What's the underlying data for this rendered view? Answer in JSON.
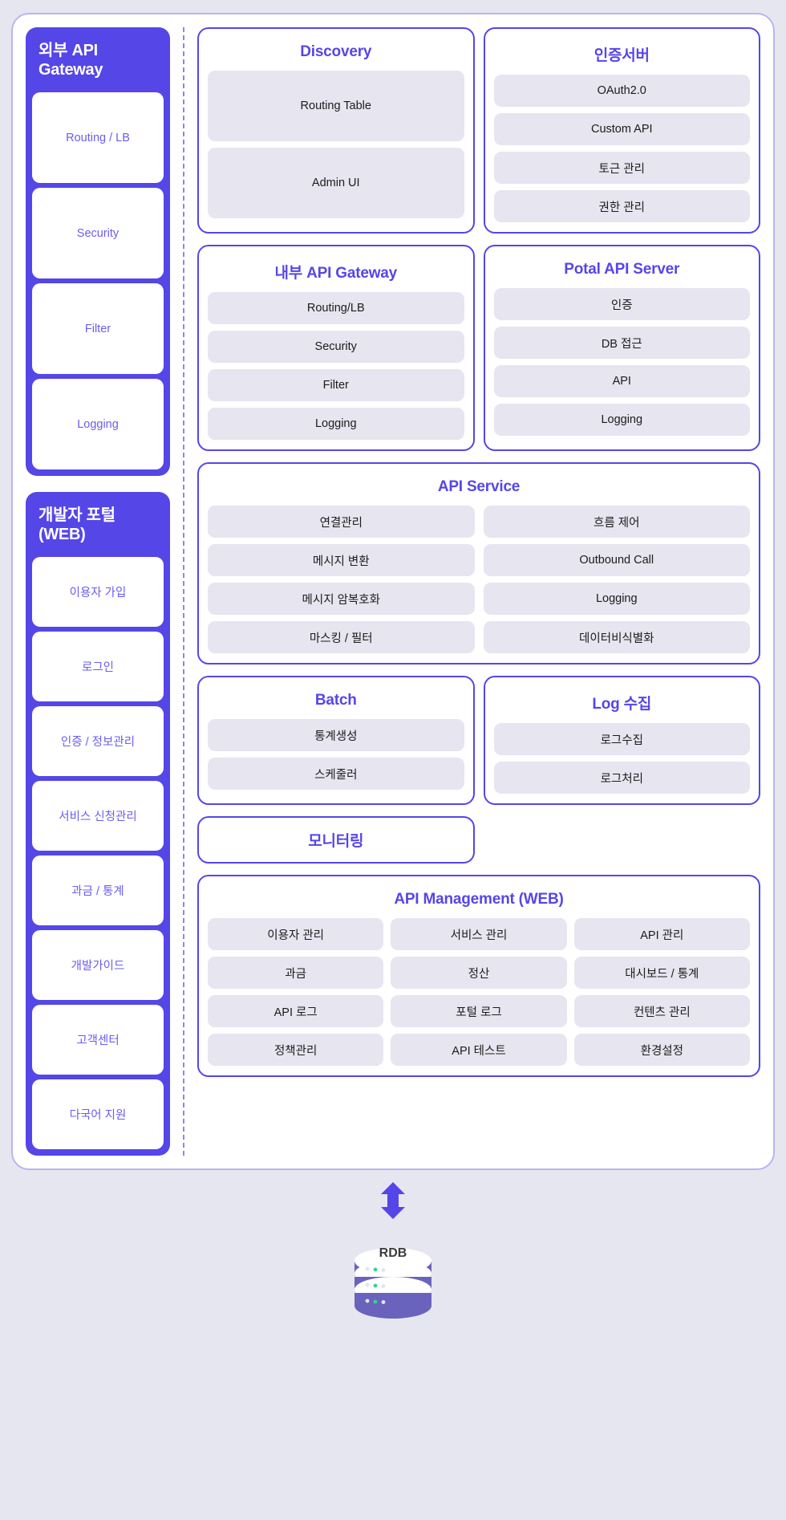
{
  "diagram": {
    "left_rail": [
      {
        "id": "external-api-gateway",
        "title": "외부 API Gateway",
        "items": [
          "Routing / LB",
          "Security",
          "Filter",
          "Logging"
        ]
      },
      {
        "id": "developer-portal",
        "title": "개발자 포털 (WEB)",
        "items": [
          "이용자 가입",
          "로그인",
          "인증 / 정보관리",
          "서비스 신청관리",
          "과금 / 통계",
          "개발가이드",
          "고객센터",
          "다국어 지원"
        ]
      }
    ],
    "cards": {
      "discovery": {
        "title": "Discovery",
        "items": [
          "Routing Table",
          "Admin UI"
        ]
      },
      "auth_server": {
        "title": "인증서버",
        "items": [
          "OAuth2.0",
          "Custom API",
          "토근 관리",
          "권한 관리"
        ]
      },
      "internal_gateway": {
        "title": "내부 API Gateway",
        "items": [
          "Routing/LB",
          "Security",
          "Filter",
          "Logging"
        ]
      },
      "potal_api_server": {
        "title": "Potal API Server",
        "items": [
          "인증",
          "DB 접근",
          "API",
          "Logging"
        ]
      },
      "api_service": {
        "title": "API Service",
        "items": [
          "연결관리",
          "흐름 제어",
          "메시지 변환",
          "Outbound Call",
          "메시지 암복호화",
          "Logging",
          "마스킹 / 필터",
          "데이터비식별화"
        ]
      },
      "batch": {
        "title": "Batch",
        "items": [
          "통계생성",
          "스케줄러"
        ]
      },
      "log_collect": {
        "title": "Log 수집",
        "items": [
          "로그수집",
          "로그처리"
        ]
      },
      "monitoring": {
        "title": "모니터링"
      },
      "api_management": {
        "title": "API Management (WEB)",
        "items": [
          "이용자 관리",
          "서비스 관리",
          "API 관리",
          "과금",
          "정산",
          "대시보드 / 통계",
          "API 로그",
          "포털 로그",
          "컨텐츠 관리",
          "정책관리",
          "API 테스트",
          "환경설정"
        ]
      }
    },
    "database": {
      "label": "RDB",
      "connector_icon": "up-down-arrow-icon",
      "icon": "database-cylinder-icon"
    },
    "colors": {
      "brand": "#5546e8",
      "brand_light": "#6a5df0",
      "chip_bg": "#e6e5f0",
      "page_bg": "#e6e6f0",
      "frame_border": "#b9b5ee",
      "divider": "#8d84ee"
    }
  }
}
